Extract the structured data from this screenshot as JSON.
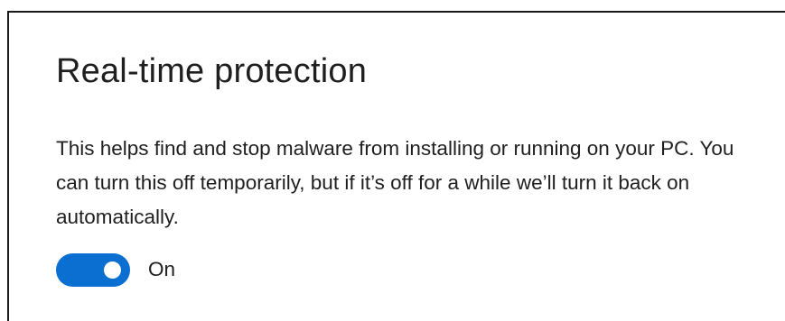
{
  "section": {
    "title": "Real-time protection",
    "description": "This helps find and stop malware from installing or running on your PC. You can turn this off temporarily, but if it’s off for a while we’ll turn it back on automatically."
  },
  "toggle": {
    "state": "on",
    "label": "On",
    "accent_color": "#0a6fd1"
  }
}
